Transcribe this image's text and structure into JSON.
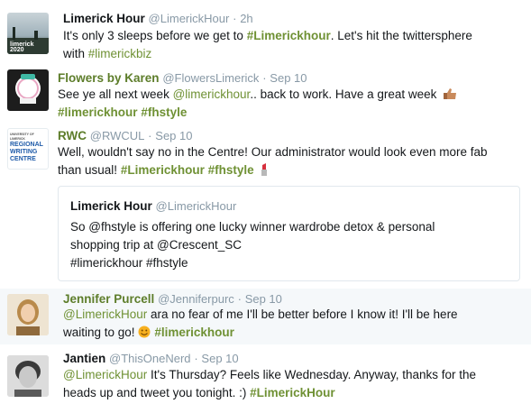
{
  "tweets": [
    {
      "name": "Limerick Hour",
      "handle": "@LimerickHour",
      "sep": "·",
      "time": "2h",
      "line1_pre": "It's only 3 sleeps before we get to ",
      "line1_tag": "#Limerickhour",
      "line1_post": ". Let's hit the twittersphere",
      "line2_pre": "with ",
      "line2_tag": "#limerickbiz",
      "avatar_text": "limerick 2020"
    },
    {
      "name": "Flowers by Karen",
      "handle": "@FlowersLimerick",
      "sep": "·",
      "time": "Sep 10",
      "line1_pre": "See ye all next week ",
      "line1_mention": "@limerickhour",
      "line1_post": ".. back to work. Have a great week",
      "line2_tag1": "#limerickhour",
      "line2_tag2": "#fhstyle"
    },
    {
      "name": "RWC",
      "handle": "@RWCUL",
      "sep": "·",
      "time": "Sep 10",
      "line1": "Well, wouldn't say no in the Centre! Our administrator would look even more fab",
      "line2_pre": "than usual! ",
      "line2_tag1": "#Limerickhour",
      "line2_tag2": "#fhstyle",
      "avatar_lines": [
        "UNIVERSITY OF LIMERICK",
        "REGIONAL",
        "WRITING",
        "CENTRE"
      ]
    },
    {
      "name": "Jennifer Purcell",
      "handle": "@Jenniferpurc",
      "sep": "·",
      "time": "Sep 10",
      "line1_mention": "@LimerickHour",
      "line1_post": " ara no fear of me I'll be better before I know it! I'll be here",
      "line2_pre": "waiting to go! ",
      "line2_tag": "#limerickhour"
    },
    {
      "name": "Jantien",
      "handle": "@ThisOneNerd",
      "sep": "·",
      "time": "Sep 10",
      "line1_mention": "@LimerickHour",
      "line1_post": " It's Thursday? Feels like Wednesday. Anyway, thanks for the",
      "line2_pre": "heads up and tweet you tonight. :) ",
      "line2_tag": "#LimerickHour"
    }
  ],
  "quote": {
    "name": "Limerick Hour",
    "handle": "@LimerickHour",
    "line1": "So @fhstyle is offering one lucky winner wardrobe detox & personal",
    "line2": "shopping trip at @Crescent_SC",
    "line3": "#limerickhour #fhstyle"
  },
  "colors": {
    "accent": "#6f9134",
    "name_green": "#5d7d2a",
    "muted": "#8899a6",
    "border": "#e1e8ed"
  },
  "icons": [
    "thumbs-up-icon",
    "lipstick-icon",
    "smiley-icon"
  ]
}
